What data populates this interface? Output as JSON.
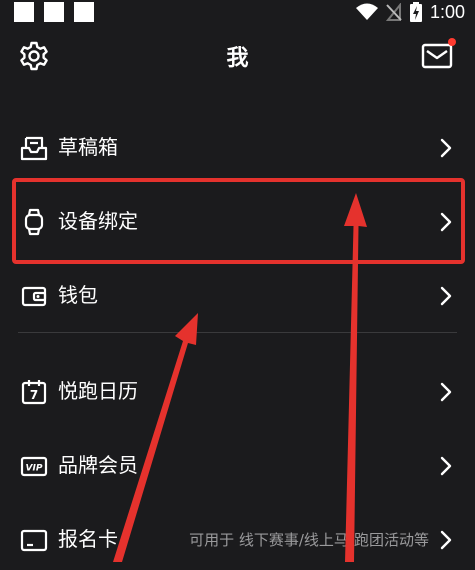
{
  "status": {
    "time": "1:00"
  },
  "header": {
    "title": "我"
  },
  "menu": {
    "drafts": {
      "label": "草稿箱"
    },
    "device": {
      "label": "设备绑定"
    },
    "wallet": {
      "label": "钱包"
    },
    "calendar": {
      "label": "悦跑日历",
      "icon_text": "7"
    },
    "vip": {
      "label": "品牌会员",
      "icon_text": "VIP"
    },
    "signup": {
      "label": "报名卡",
      "hint": "可用于 线下赛事/线上马/跑团活动等"
    }
  },
  "colors": {
    "background": "#1b1b1d",
    "annotation": "#e5322d",
    "notification_dot": "#ff3b30",
    "hint_text": "#9a9a9c"
  }
}
